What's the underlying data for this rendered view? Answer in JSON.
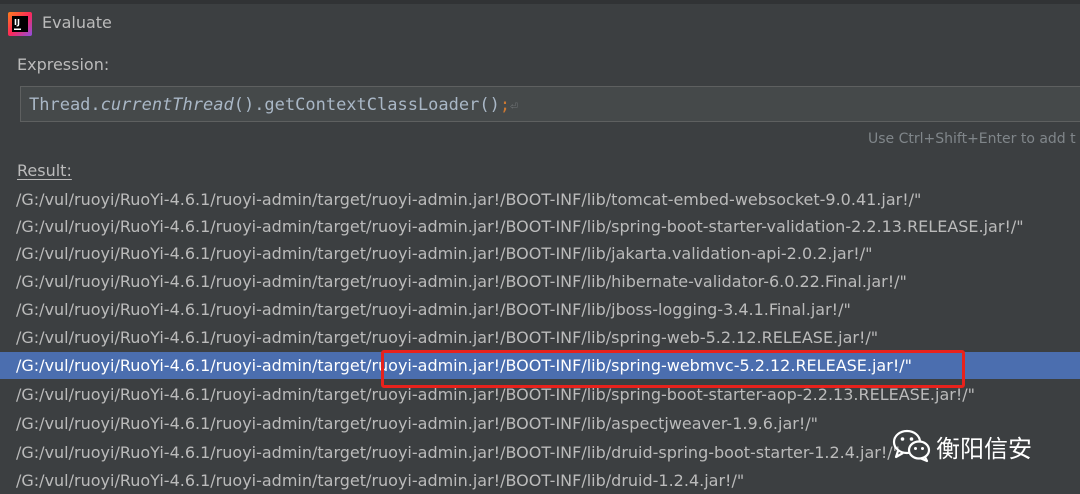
{
  "window": {
    "title": "Evaluate"
  },
  "expression": {
    "label": "Expression:",
    "tokens": {
      "t1": "Thread.",
      "t2": "currentThread",
      "t3": "().getContextClassLoader()",
      "t4": ";",
      "t5": "⏎"
    },
    "hint": "Use Ctrl+Shift+Enter to add t"
  },
  "result": {
    "label_mnemonic": "R",
    "label_rest": "esult:",
    "rows": [
      "/G:/vul/ruoyi/RuoYi-4.6.1/ruoyi-admin/target/ruoyi-admin.jar!/BOOT-INF/lib/tomcat-embed-websocket-9.0.41.jar!/\"",
      "/G:/vul/ruoyi/RuoYi-4.6.1/ruoyi-admin/target/ruoyi-admin.jar!/BOOT-INF/lib/spring-boot-starter-validation-2.2.13.RELEASE.jar!/\"",
      "/G:/vul/ruoyi/RuoYi-4.6.1/ruoyi-admin/target/ruoyi-admin.jar!/BOOT-INF/lib/jakarta.validation-api-2.0.2.jar!/\"",
      "/G:/vul/ruoyi/RuoYi-4.6.1/ruoyi-admin/target/ruoyi-admin.jar!/BOOT-INF/lib/hibernate-validator-6.0.22.Final.jar!/\"",
      "/G:/vul/ruoyi/RuoYi-4.6.1/ruoyi-admin/target/ruoyi-admin.jar!/BOOT-INF/lib/jboss-logging-3.4.1.Final.jar!/\"",
      "/G:/vul/ruoyi/RuoYi-4.6.1/ruoyi-admin/target/ruoyi-admin.jar!/BOOT-INF/lib/spring-web-5.2.12.RELEASE.jar!/\"",
      "/G:/vul/ruoyi/RuoYi-4.6.1/ruoyi-admin/target/ruoyi-admin.jar!/BOOT-INF/lib/spring-webmvc-5.2.12.RELEASE.jar!/\"",
      "/G:/vul/ruoyi/RuoYi-4.6.1/ruoyi-admin/target/ruoyi-admin.jar!/BOOT-INF/lib/spring-boot-starter-aop-2.2.13.RELEASE.jar!/\"",
      "/G:/vul/ruoyi/RuoYi-4.6.1/ruoyi-admin/target/ruoyi-admin.jar!/BOOT-INF/lib/aspectjweaver-1.9.6.jar!/\"",
      "/G:/vul/ruoyi/RuoYi-4.6.1/ruoyi-admin/target/ruoyi-admin.jar!/BOOT-INF/lib/druid-spring-boot-starter-1.2.4.jar!/\"",
      "/G:/vul/ruoyi/RuoYi-4.6.1/ruoyi-admin/target/ruoyi-admin.jar!/BOOT-INF/lib/druid-1.2.4.jar!/\""
    ],
    "selected_index": 6
  },
  "watermark": {
    "text": "衡阳信安",
    "icon": "wechat-icon"
  },
  "colors": {
    "background": "#3c3f41",
    "selection": "#4b6eaf",
    "highlight_border": "#e8221c",
    "semicolon": "#cc7832"
  }
}
